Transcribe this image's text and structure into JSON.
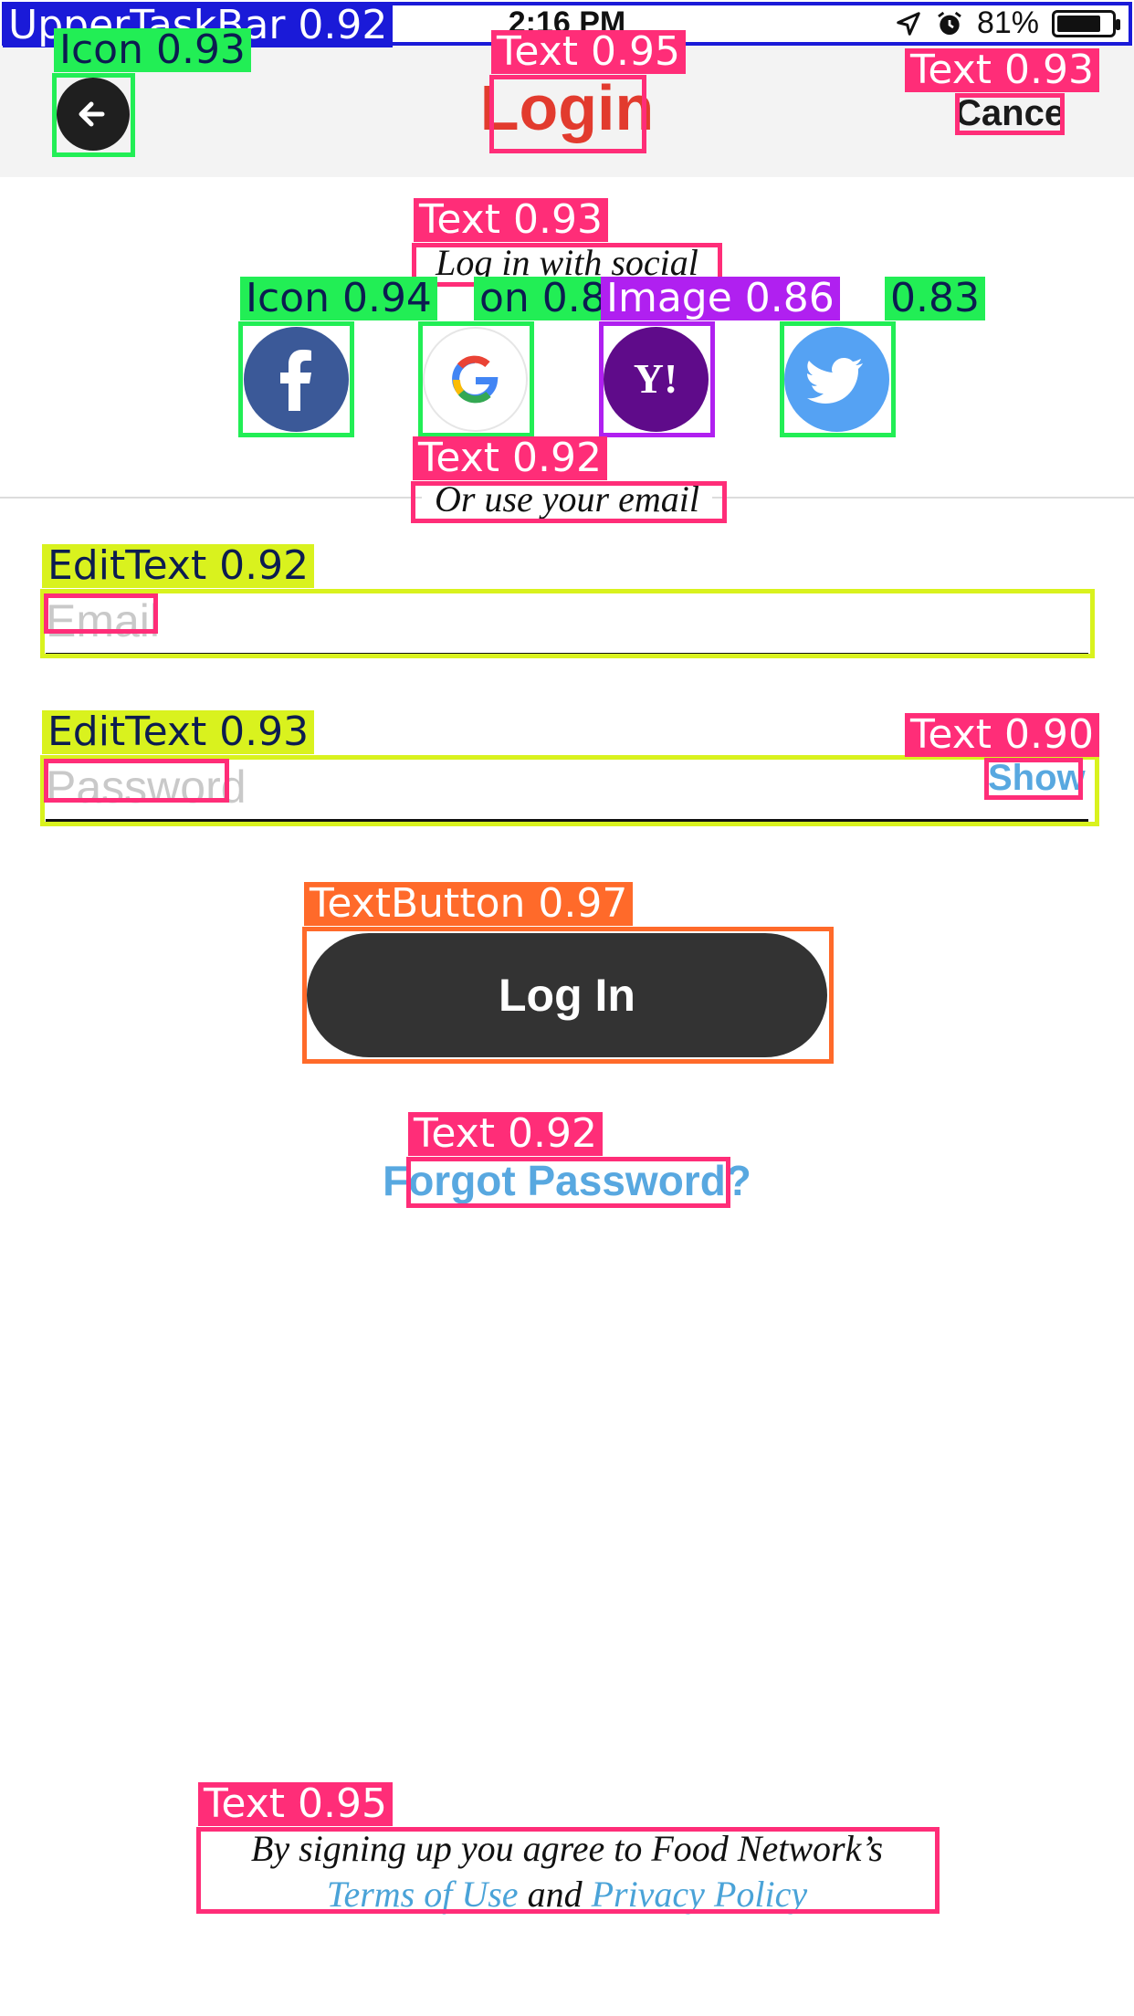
{
  "status_bar": {
    "time": "2:16 PM",
    "battery_percent": "81%",
    "battery_level": 0.81,
    "icons": [
      "location-arrow-icon",
      "alarm-icon",
      "battery-icon"
    ]
  },
  "header": {
    "title": "Login",
    "cancel_label": "Cance",
    "back_icon": "arrow-left-icon"
  },
  "social": {
    "heading": "Log in with social",
    "providers": [
      {
        "name": "facebook-icon"
      },
      {
        "name": "google-icon"
      },
      {
        "name": "yahoo-icon",
        "glyph": "Y!"
      },
      {
        "name": "twitter-icon"
      }
    ]
  },
  "email_section": {
    "heading": "Or use your email"
  },
  "form": {
    "email_placeholder": "Email",
    "password_placeholder": "Password",
    "show_label": "Show",
    "login_button": "Log In",
    "forgot_label": "Forgot Password?"
  },
  "legal": {
    "prefix": "By signing up you agree to Food Network’s",
    "terms": "Terms of Use",
    "and": "and",
    "privacy": "Privacy Policy"
  },
  "detections": {
    "upper_taskbar": "UpperTaskBar 0.92",
    "back_icon": "Icon 0.93",
    "title": "Text 0.95",
    "cancel": "Text 0.93",
    "social_heading": "Text 0.93",
    "fb_icon": "Icon 0.94",
    "google_icon": "on 0.8",
    "yahoo_image": "Image 0.86",
    "twitter_icon": "0.83",
    "email_heading": "Text 0.92",
    "email_edit": "EditText 0.92",
    "password_edit": "EditText 0.93",
    "show_text": "Text 0.90",
    "login_button": "TextButton 0.97",
    "forgot_text": "Text 0.92",
    "legal_text": "Text 0.95"
  },
  "colors": {
    "title": "#e23b2e",
    "link": "#4aa3d8",
    "button_bg": "#333333",
    "facebook": "#3b5998",
    "yahoo": "#5f0b8a",
    "twitter": "#55a2f3"
  }
}
